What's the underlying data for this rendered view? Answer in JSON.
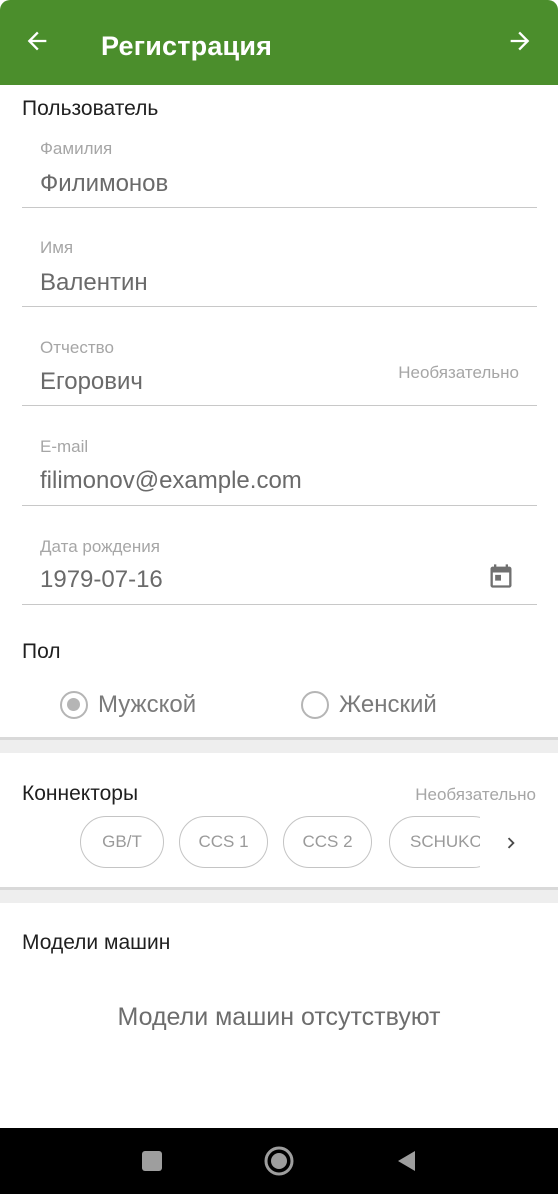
{
  "header": {
    "title": "Регистрация",
    "back_icon": "arrow-left-icon",
    "forward_icon": "arrow-right-icon",
    "color": "#4b8e2c"
  },
  "user": {
    "section_title": "Пользователь",
    "last_name": {
      "label": "Фамилия",
      "value": "Филимонов"
    },
    "first_name": {
      "label": "Имя",
      "value": "Валентин"
    },
    "patronymic": {
      "label": "Отчество",
      "value": "Егорович",
      "hint": "Необязательно"
    },
    "email": {
      "label": "E-mail",
      "value": "filimonov@example.com"
    },
    "birth_date": {
      "label": "Дата рождения",
      "value": "1979-07-16",
      "icon": "calendar-icon"
    }
  },
  "gender": {
    "section_title": "Пол",
    "options": [
      {
        "label": "Мужской",
        "selected": true
      },
      {
        "label": "Женский",
        "selected": false
      }
    ]
  },
  "connectors": {
    "section_title": "Коннекторы",
    "hint": "Необязательно",
    "chips": [
      "GB/T",
      "CCS 1",
      "CCS 2",
      "SCHUKO"
    ],
    "next_icon": "chevron-right-icon"
  },
  "car_models": {
    "section_title": "Модели машин",
    "empty_text": "Модели машин отсутствуют"
  },
  "system_nav": {
    "recents_icon": "square-icon",
    "home_icon": "circle-home-icon",
    "back_icon": "triangle-back-icon"
  }
}
